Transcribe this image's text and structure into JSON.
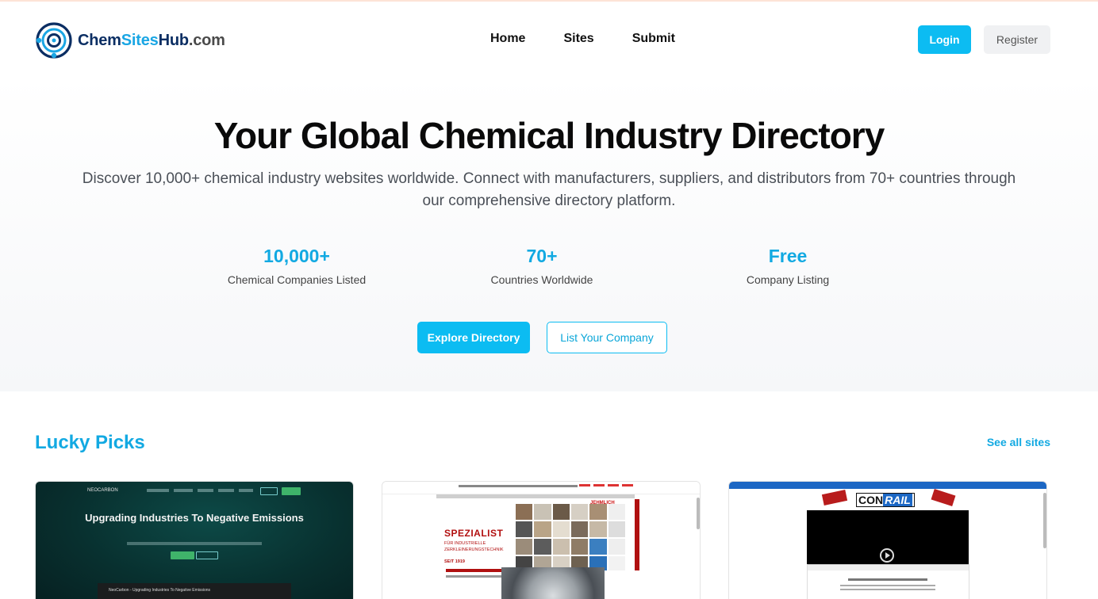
{
  "header": {
    "logo": {
      "part1": "Chem",
      "part2": "Sites",
      "part3": "Hub",
      "part4": ".com"
    },
    "nav": [
      "Home",
      "Sites",
      "Submit"
    ],
    "login_label": "Login",
    "register_label": "Register"
  },
  "hero": {
    "title": "Your Global Chemical Industry Directory",
    "subtitle": "Discover 10,000+ chemical industry websites worldwide. Connect with manufacturers, suppliers, and distributors from 70+ countries through our comprehensive directory platform.",
    "stats": [
      {
        "value": "10,000+",
        "label": "Chemical Companies Listed"
      },
      {
        "value": "70+",
        "label": "Countries Worldwide"
      },
      {
        "value": "Free",
        "label": "Company Listing"
      }
    ],
    "explore_label": "Explore Directory",
    "list_label": "List Your Company"
  },
  "lucky_picks": {
    "title": "Lucky Picks",
    "see_all_label": "See all sites",
    "cards": [
      {
        "preview_title": "Upgrading Industries To Negative Emissions",
        "preview_logo": "NEOCARBON",
        "preview_video": "NeoCarbon - Upgrading Industries To Negative Emissions"
      },
      {
        "preview_heading": "SPEZIALIST",
        "preview_sub": "FÜR INDUSTRIELLE ZERKLEINERUNGSTECHNIK",
        "preview_since": "SEIT 1919",
        "preview_logo": "JEHMLICH"
      },
      {
        "preview_logo_a": "CON",
        "preview_logo_b": "RAIL"
      }
    ]
  },
  "colors": {
    "accent": "#0cbcf2",
    "accent_text": "#12a9e2",
    "logo_dark": "#0b2e63"
  }
}
